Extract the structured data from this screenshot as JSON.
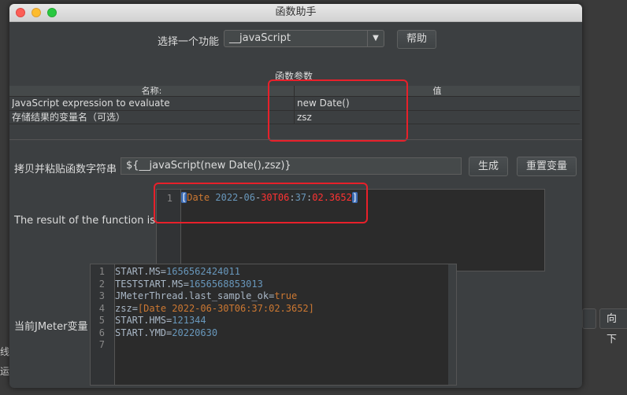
{
  "window": {
    "title": "函数助手"
  },
  "function_select": {
    "label": "选择一个功能",
    "value": "__javaScript",
    "help_button": "帮助"
  },
  "params": {
    "section_title": "函数参数",
    "columns": [
      "名称:",
      "值"
    ],
    "rows": [
      {
        "name": "JavaScript expression to evaluate",
        "value": "new Date()"
      },
      {
        "name": "存储结果的变量名（可选）",
        "value": "zsz"
      }
    ]
  },
  "copy_string": {
    "label": "拷贝并粘贴函数字符串",
    "value": "${__javaScript(new Date(),zsz)}",
    "generate_button": "生成",
    "reset_button": "重置变量"
  },
  "result": {
    "label": "The result of the function is",
    "line_number": "1",
    "tokens": {
      "open": "[",
      "word": "Date",
      "year": "2022",
      "d1": "-",
      "month": "06",
      "d2": "-",
      "day": "30T06",
      "c1": ":",
      "min": "37",
      "c2": ":",
      "sec": "02.3652",
      "close": "]"
    }
  },
  "variables": {
    "label": "当前JMeter变量",
    "line_numbers": [
      "1",
      "2",
      "3",
      "4",
      "5",
      "6",
      "7"
    ],
    "lines": [
      {
        "key": "START.MS",
        "eq": "=",
        "value": "1656562424011"
      },
      {
        "key": "TESTSTART.MS",
        "eq": "=",
        "value": "1656568853013"
      },
      {
        "key": "JMeterThread.last_sample_ok",
        "eq": "=",
        "value": "true"
      },
      {
        "key": "zsz",
        "eq": "=",
        "value": "[Date 2022-06-30T06:37:02.3652]"
      },
      {
        "key": "START.HMS",
        "eq": "=",
        "value": "121344"
      },
      {
        "key": "START.YMD",
        "eq": "=",
        "value": "20220630"
      }
    ]
  },
  "background": {
    "next_button": "向下",
    "side_label_1": "线程",
    "side_label_2": "运行"
  },
  "colors": {
    "highlight_box": "#e8202a",
    "number": "#6897bb",
    "keyword": "#cc7832",
    "date_red": "#ff3333"
  }
}
